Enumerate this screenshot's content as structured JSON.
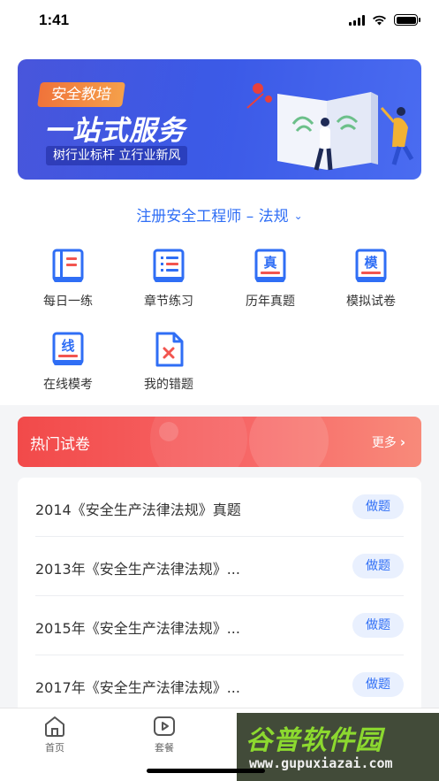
{
  "status_bar": {
    "time": "1:41"
  },
  "banner": {
    "tag": "安全教培",
    "title": "一站式服务",
    "subtitle": "树行业标杆 立行业新风"
  },
  "subject_selector": {
    "label": "注册安全工程师 – 法规",
    "icon": "chevron-down-icon"
  },
  "features": [
    {
      "label": "每日一练",
      "icon": "book-icon"
    },
    {
      "label": "章节练习",
      "icon": "list-book-icon"
    },
    {
      "label": "历年真题",
      "icon": "zhen-book-icon",
      "glyph": "真"
    },
    {
      "label": "模拟试卷",
      "icon": "mo-book-icon",
      "glyph": "模"
    },
    {
      "label": "在线模考",
      "icon": "xian-book-icon",
      "glyph": "线"
    },
    {
      "label": "我的错题",
      "icon": "error-document-icon"
    }
  ],
  "hot_papers": {
    "title": "热门试卷",
    "more_label": "更多",
    "items": [
      {
        "title": "2014《安全生产法律法规》真题",
        "action": "做题"
      },
      {
        "title": "2013年《安全生产法律法规》...",
        "action": "做题"
      },
      {
        "title": "2015年《安全生产法律法规》...",
        "action": "做题"
      },
      {
        "title": "2017年《安全生产法律法规》...",
        "action": "做题"
      }
    ]
  },
  "tabbar": {
    "items": [
      {
        "label": "首页",
        "icon": "home-icon"
      },
      {
        "label": "套餐",
        "icon": "play-icon"
      }
    ]
  },
  "watermark": {
    "text": "谷普软件园",
    "url": "www.gupuxiazai.com"
  },
  "colors": {
    "accent": "#2f6ef5",
    "hot_red": "#f24a4a",
    "banner_blue": "#3a58e6",
    "icon_red": "#f2554f"
  }
}
